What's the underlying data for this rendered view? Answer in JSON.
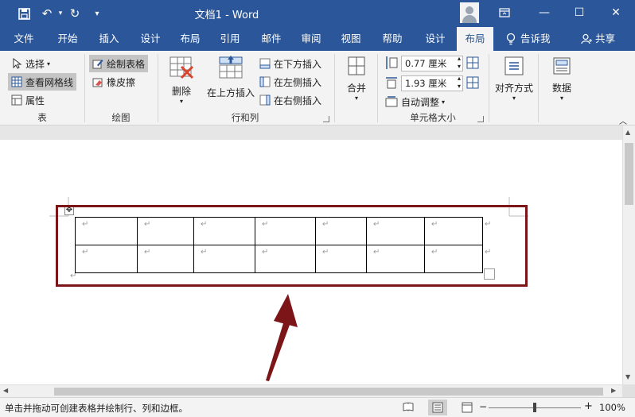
{
  "window": {
    "title": "文档1  -  Word"
  },
  "tabs": [
    {
      "label": "文件"
    },
    {
      "label": "开始"
    },
    {
      "label": "插入"
    },
    {
      "label": "设计"
    },
    {
      "label": "布局"
    },
    {
      "label": "引用"
    },
    {
      "label": "邮件"
    },
    {
      "label": "审阅"
    },
    {
      "label": "视图"
    },
    {
      "label": "帮助"
    },
    {
      "label": "设计"
    },
    {
      "label": "布局"
    }
  ],
  "active_tab_index": 11,
  "tell_me": "告诉我",
  "share": "共享",
  "ribbon": {
    "table_group": {
      "select": "选择",
      "view_gridlines": "查看网格线",
      "properties": "属性",
      "label": "表"
    },
    "draw_group": {
      "draw_table": "绘制表格",
      "eraser": "橡皮擦",
      "label": "绘图"
    },
    "rows_cols_group": {
      "delete": "删除",
      "insert_above": "在上方插入",
      "insert_below": "在下方插入",
      "insert_left": "在左侧插入",
      "insert_right": "在右侧插入",
      "label": "行和列"
    },
    "merge_group": {
      "merge": "合并"
    },
    "cell_size_group": {
      "height": "0.77 厘米",
      "width": "1.93 厘米",
      "autofit": "自动调整",
      "label": "单元格大小"
    },
    "alignment": "对齐方式",
    "data": "数据"
  },
  "document": {
    "table": {
      "rows": 2,
      "cols": 7,
      "cell_mark": "↵"
    },
    "paragraph_mark": "↵"
  },
  "status": {
    "message": "单击并拖动可创建表格并绘制行、列和边框。",
    "zoom": "100%"
  },
  "colors": {
    "title_bar": "#2b579a",
    "ribbon": "#f3f3f3",
    "annotation": "#7b1518"
  }
}
